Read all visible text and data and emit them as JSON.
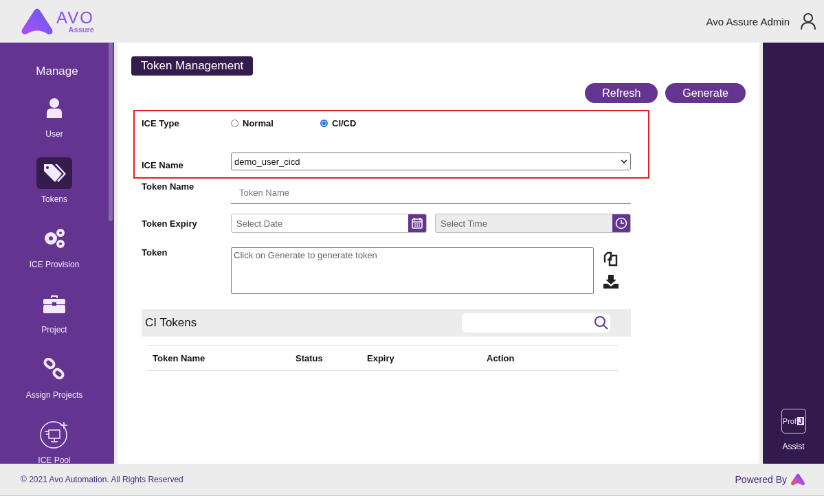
{
  "header": {
    "logo_text": "AVO",
    "logo_subtext": "Assure",
    "user_name": "Avo Assure Admin"
  },
  "sidebar": {
    "title": "Manage",
    "items": [
      {
        "label": "User",
        "selected": false
      },
      {
        "label": "Tokens",
        "selected": true
      },
      {
        "label": "ICE Provision",
        "selected": false
      },
      {
        "label": "Project",
        "selected": false
      },
      {
        "label": "Assign Projects",
        "selected": false
      },
      {
        "label": "ICE Pool",
        "selected": false
      }
    ]
  },
  "page_title": "Token Management",
  "buttons": [
    "Refresh",
    "Generate"
  ],
  "form": {
    "ice_type": {
      "label": "ICE Type",
      "options": [
        {
          "label": "Normal",
          "selected": false
        },
        {
          "label": "CI/CD",
          "selected": true
        }
      ]
    },
    "ice_name": {
      "label": "ICE Name",
      "value": "demo_user_cicd"
    },
    "token_name": {
      "label": "Token Name",
      "placeholder": "Token Name"
    },
    "token_expiry": {
      "label": "Token Expiry",
      "date": {
        "placeholder": "Select Date",
        "disabled": false
      },
      "time": {
        "placeholder": "Select Time",
        "disabled": true
      }
    },
    "token": {
      "label": "Token",
      "placeholder": "Click on Generate to generate token"
    }
  },
  "ci_tokens": {
    "title": "CI Tokens",
    "columns": [
      "Token Name",
      "Status",
      "Expiry",
      "Action"
    ]
  },
  "assist": {
    "logo_text": "Prof",
    "logo_mark": "J",
    "label": "Assist"
  },
  "footer": {
    "copyright": "© 2021 Avo Automation. All Rights Reserved",
    "powered_by": "Powered By"
  }
}
